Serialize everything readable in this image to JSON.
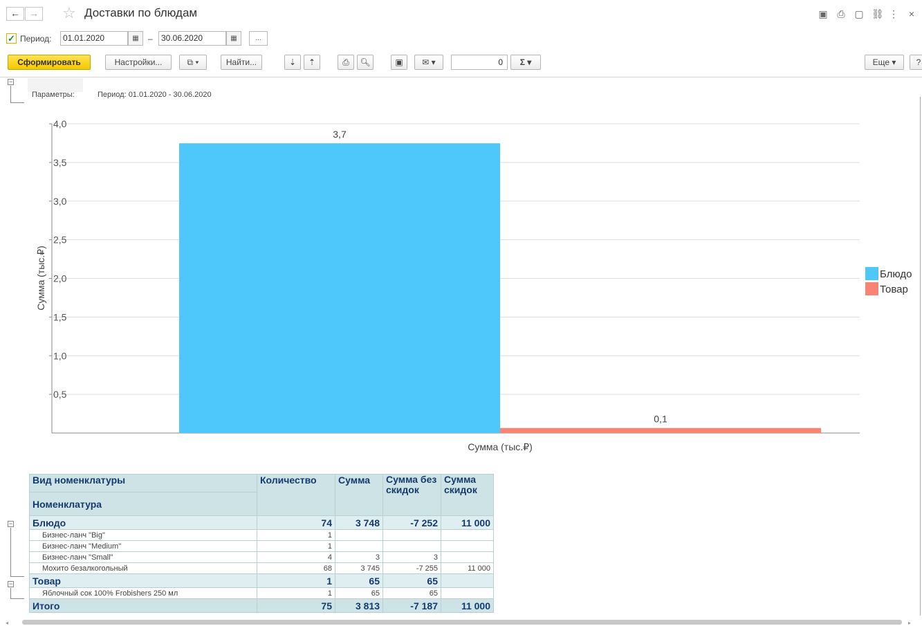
{
  "window": {
    "title": "Доставки по блюдам"
  },
  "nav": {
    "back": "←",
    "forward": "→",
    "star": "☆"
  },
  "period": {
    "label": "Период:",
    "from": "01.01.2020",
    "dash": "–",
    "to": "30.06.2020",
    "more": "..."
  },
  "toolbar": {
    "generate": "Сформировать",
    "settings": "Настройки...",
    "find": "Найти...",
    "sum_value": "0",
    "sigma": "Σ",
    "more": "Еще",
    "help": "?"
  },
  "params": {
    "label": "Параметры:",
    "value": "Период: 01.01.2020 - 30.06.2020"
  },
  "chart_data": {
    "type": "bar",
    "categories": [
      "Сумма (тыс.₽)"
    ],
    "series": [
      {
        "name": "Блюдо",
        "values": [
          3.748
        ],
        "label": "3,7",
        "color": "#4ec8fa"
      },
      {
        "name": "Товар",
        "values": [
          0.065
        ],
        "label": "0,1",
        "color": "#fa8474"
      }
    ],
    "xlabel": "Сумма (тыс.₽)",
    "ylabel": "Сумма (тыс.₽)",
    "ylim": [
      0,
      4.0
    ],
    "yticks": [
      "0,5",
      "1,0",
      "1,5",
      "2,0",
      "2,5",
      "3,0",
      "3,5",
      "4,0"
    ],
    "grid": true,
    "legend": "right"
  },
  "table": {
    "headers": {
      "col1_top": "Вид номенклатуры",
      "col1_bottom": "Номенклатура",
      "qty": "Количество",
      "sum": "Сумма",
      "sum_no_disc": "Сумма без скидок",
      "disc": "Сумма скидок"
    },
    "groups": [
      {
        "name": "Блюдо",
        "qty": "74",
        "sum": "3 748",
        "sum_no_disc": "-7 252",
        "disc": "11 000",
        "rows": [
          {
            "name": "Бизнес-ланч \"Big\"",
            "qty": "1",
            "sum": "",
            "sum_no_disc": "",
            "disc": ""
          },
          {
            "name": "Бизнес-ланч \"Medium\"",
            "qty": "1",
            "sum": "",
            "sum_no_disc": "",
            "disc": ""
          },
          {
            "name": "Бизнес-ланч \"Small\"",
            "qty": "4",
            "sum": "3",
            "sum_no_disc": "3",
            "disc": ""
          },
          {
            "name": "Мохито безалкогольный",
            "qty": "68",
            "sum": "3 745",
            "sum_no_disc": "-7 255",
            "disc": "11 000"
          }
        ]
      },
      {
        "name": "Товар",
        "qty": "1",
        "sum": "65",
        "sum_no_disc": "65",
        "disc": "",
        "rows": [
          {
            "name": "Яблочный сок 100% Frobishers 250 мл",
            "qty": "1",
            "sum": "65",
            "sum_no_disc": "65",
            "disc": ""
          }
        ]
      }
    ],
    "total": {
      "name": "Итого",
      "qty": "75",
      "sum": "3 813",
      "sum_no_disc": "-7 187",
      "disc": "11 000"
    }
  }
}
